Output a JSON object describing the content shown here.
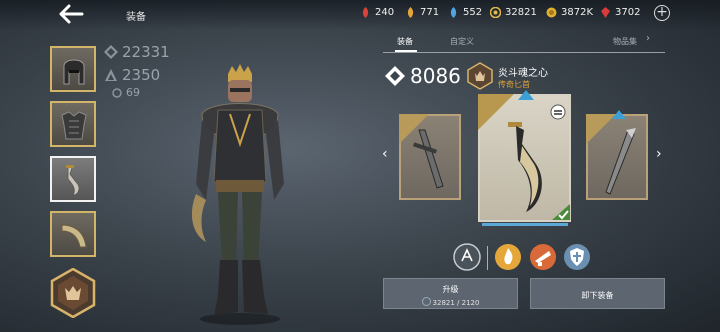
{
  "header": {
    "title": "装备"
  },
  "resources": [
    {
      "icon": "red-leaf-icon",
      "value": "240",
      "color": "#d9433a"
    },
    {
      "icon": "gold-leaf-icon",
      "value": "771",
      "color": "#e2a63a"
    },
    {
      "icon": "blue-leaf-icon",
      "value": "552",
      "color": "#4ea7e0"
    },
    {
      "icon": "coin-icon",
      "value": "32821",
      "color": "#e3b94a"
    },
    {
      "icon": "gold-coin-icon",
      "value": "3872K",
      "color": "#e0b030"
    },
    {
      "icon": "red-gem-icon",
      "value": "3702",
      "color": "#d93a3a"
    }
  ],
  "stats": {
    "power": "22331",
    "defense": "2350",
    "other": "69"
  },
  "tabs": [
    {
      "label": "装备",
      "active": true
    },
    {
      "label": "自定义",
      "active": false
    },
    {
      "label": "物品集",
      "active": false
    }
  ],
  "item": {
    "power": "8086",
    "name": "炎斗魂之心",
    "rarity": "传奇匕首",
    "rarity_color": "#e6a73a"
  },
  "buttons": {
    "upgrade_label": "升级",
    "upgrade_cost": "32821 / 2120",
    "unequip_label": "卸下装备"
  }
}
